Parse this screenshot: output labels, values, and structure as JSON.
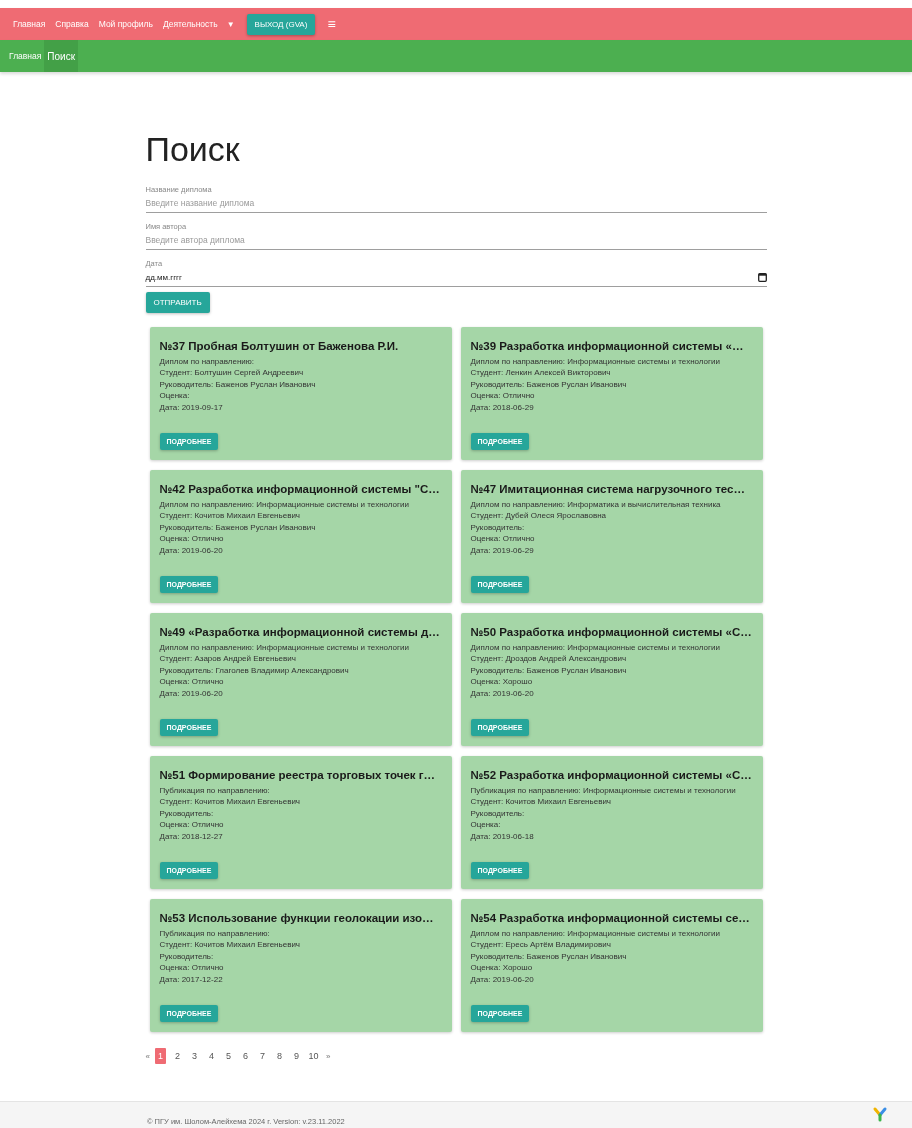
{
  "nav": {
    "links": [
      "Главная",
      "Справка",
      "Мой профиль",
      "Деятельность"
    ],
    "dropdown_caret": "▼",
    "logout": "ВЫХОД (GVA)",
    "menu_icon": "≡"
  },
  "breadcrumbs": [
    {
      "label": "Главная",
      "selected": false
    },
    {
      "label": "Поиск",
      "selected": true
    }
  ],
  "title": "Поиск",
  "form": {
    "fields": [
      {
        "kind": "text",
        "label": "Название диплома",
        "placeholder": "Введите название диплома"
      },
      {
        "kind": "text",
        "label": "Имя автора",
        "placeholder": "Введите автора диплома"
      },
      {
        "kind": "date",
        "label": "Дата",
        "value": "дд.мм.гггг"
      }
    ],
    "submit": "ОТПРАВИТЬ"
  },
  "cards": [
    {
      "title": "№37 Пробная Болтушин от Баженова Р.И.",
      "lines": [
        "Диплом по направлению:",
        "Студент: Болтушин Сергей Андреевич",
        "Руководитель: Баженов Руслан Иванович",
        "Оценка:",
        "Дата: 2019-09-17"
      ],
      "button": "ПОДРОБНЕЕ"
    },
    {
      "title": "№39 Разработка информационной системы «…",
      "lines": [
        "Диплом по направлению: Информационные системы и технологии",
        "Студент: Ленкин Алексей Викторович",
        "Руководитель: Баженов Руслан Иванович",
        "Оценка: Отлично",
        "Дата: 2018-06-29"
      ],
      "button": "ПОДРОБНЕЕ"
    },
    {
      "title": "№42 Разработка информационной системы \"С…",
      "lines": [
        "Диплом по направлению: Информационные системы и технологии",
        "Студент: Кочитов Михаил Евгеньевич",
        "Руководитель: Баженов Руслан Иванович",
        "Оценка: Отлично",
        "Дата: 2019-06-20"
      ],
      "button": "ПОДРОБНЕЕ"
    },
    {
      "title": "№47 Имитационная система нагрузочного тес…",
      "lines": [
        "Диплом по направлению: Информатика и вычислительная техника",
        "Студент: Дубей Олеся Ярославовна",
        "Руководитель:",
        "Оценка: Отлично",
        "Дата: 2019-06-29"
      ],
      "button": "ПОДРОБНЕЕ"
    },
    {
      "title": "№49 «Разработка информационной системы д…",
      "lines": [
        "Диплом по направлению: Информационные системы и технологии",
        "Студент: Азаров Андрей Евгеньевич",
        "Руководитель: Глаголев Владимир Александрович",
        "Оценка: Отлично",
        "Дата: 2019-06-20"
      ],
      "button": "ПОДРОБНЕЕ"
    },
    {
      "title": "№50 Разработка информационной системы «С…",
      "lines": [
        "Диплом по направлению: Информационные системы и технологии",
        "Студент: Дроздов Андрей Александрович",
        "Руководитель: Баженов Руслан Иванович",
        "Оценка: Хорошо",
        "Дата: 2019-06-20"
      ],
      "button": "ПОДРОБНЕЕ"
    },
    {
      "title": "№51 Формирование реестра торговых точек г…",
      "lines": [
        "Публикация по направлению:",
        "Студент: Кочитов Михаил Евгеньевич",
        "Руководитель:",
        "Оценка: Отлично",
        "Дата: 2018-12-27"
      ],
      "button": "ПОДРОБНЕЕ"
    },
    {
      "title": "№52 Разработка информационной системы «С…",
      "lines": [
        "Публикация по направлению: Информационные системы и технологии",
        "Студент: Кочитов Михаил Евгеньевич",
        "Руководитель:",
        "Оценка:",
        "Дата: 2019-06-18"
      ],
      "button": "ПОДРОБНЕЕ"
    },
    {
      "title": "№53 Использование функции геолокации изо…",
      "lines": [
        "Публикация по направлению:",
        "Студент: Кочитов Михаил Евгеньевич",
        "Руководитель:",
        "Оценка: Отлично",
        "Дата: 2017-12-22"
      ],
      "button": "ПОДРОБНЕЕ"
    },
    {
      "title": "№54 Разработка информационной системы се…",
      "lines": [
        "Диплом по направлению: Информационные системы и технологии",
        "Студент: Ересь Артём Владимирович",
        "Руководитель: Баженов Руслан Иванович",
        "Оценка: Хорошо",
        "Дата: 2019-06-20"
      ],
      "button": "ПОДРОБНЕЕ"
    }
  ],
  "pagination": {
    "prev": "«",
    "pages": [
      {
        "label": "1",
        "selected": true
      },
      {
        "label": "2",
        "selected": false
      },
      {
        "label": "3",
        "selected": false
      },
      {
        "label": "4",
        "selected": false
      },
      {
        "label": "5",
        "selected": false
      },
      {
        "label": "6",
        "selected": false
      },
      {
        "label": "7",
        "selected": false
      },
      {
        "label": "8",
        "selected": false
      },
      {
        "label": "9",
        "selected": false
      },
      {
        "label": "10",
        "selected": false
      }
    ],
    "next": "»"
  },
  "footer": "© ПГУ им. Шолом-Алейхема 2024 г. Version: v.23.11.2022"
}
